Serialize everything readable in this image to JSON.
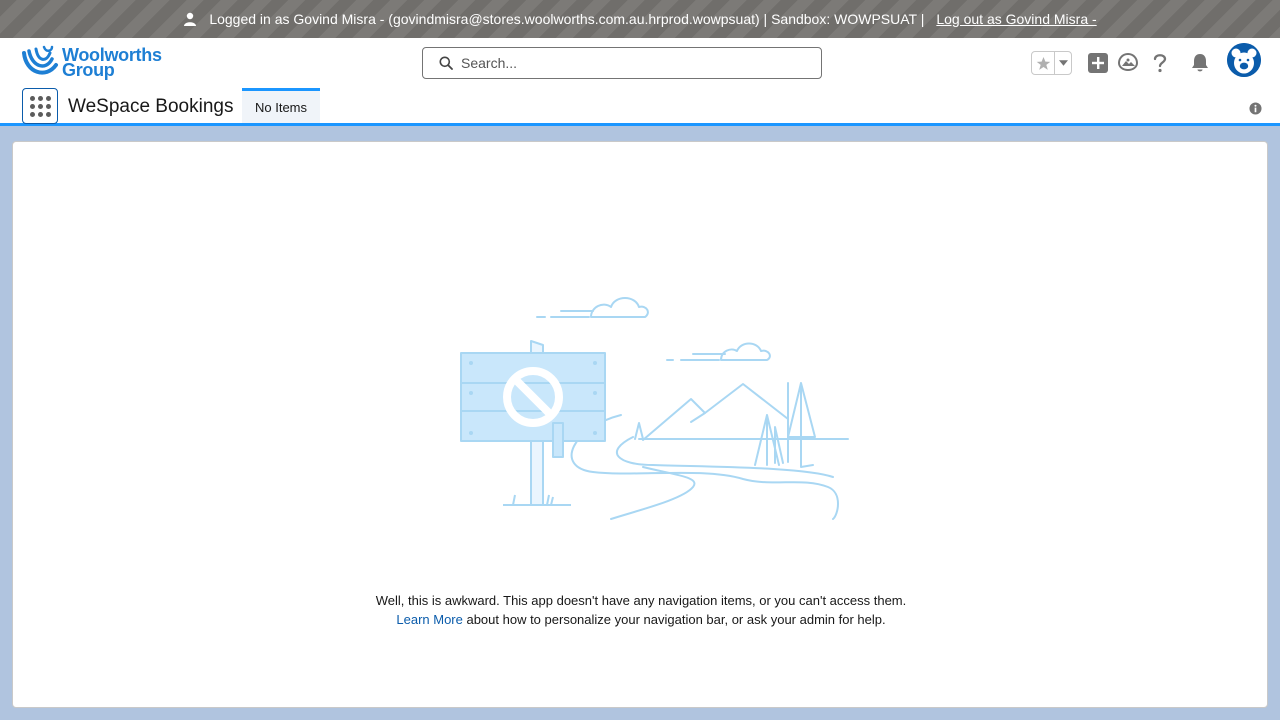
{
  "banner": {
    "text": "Logged in as Govind Misra - (govindmisra@stores.woolworths.com.au.hrprod.wowpsuat) | Sandbox: WOWPSUAT |",
    "logout_label": "Log out as Govind Misra -",
    "icon": "user-icon"
  },
  "header": {
    "logo_line1": "Woolworths",
    "logo_line2": "Group",
    "search_placeholder": "Search...",
    "icons": [
      "star-icon",
      "chevron-down-icon",
      "add-icon",
      "trailhead-icon",
      "help-icon",
      "bell-icon",
      "avatar"
    ]
  },
  "app_nav": {
    "app_name": "WeSpace Bookings",
    "tab_label": "No Items"
  },
  "main": {
    "message_line1": "Well, this is awkward. This app doesn't have any navigation items, or you can't access them.",
    "learn_more": "Learn More",
    "message_line2": " about how to personalize your navigation bar, or ask your admin for help."
  },
  "colors": {
    "accent": "#1b96ff",
    "link": "#0b5cab",
    "illustration": "#a9d7f3",
    "background": "#b0c4df"
  }
}
